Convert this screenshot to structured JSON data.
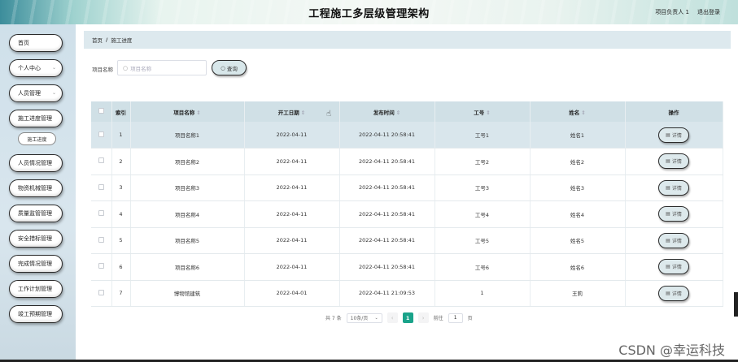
{
  "header": {
    "title": "工程施工多层级管理架构",
    "user_label": "项目负责人 1",
    "logout_label": "退出登录"
  },
  "sidebar": {
    "items": [
      {
        "label": "首页",
        "expandable": false
      },
      {
        "label": "个人中心",
        "expandable": true
      },
      {
        "label": "人员管理",
        "expandable": true
      },
      {
        "label": "施工进度管理",
        "expandable": false
      },
      {
        "label": "人员情况管理",
        "expandable": false
      },
      {
        "label": "物资机械管理",
        "expandable": false
      },
      {
        "label": "质量监管管理",
        "expandable": false
      },
      {
        "label": "安全措标管理",
        "expandable": false
      },
      {
        "label": "完成情况管理",
        "expandable": false
      },
      {
        "label": "工作计划管理",
        "expandable": false
      },
      {
        "label": "竣工预期管理",
        "expandable": false
      }
    ],
    "sub_item": "施工进度"
  },
  "breadcrumb": {
    "home": "首页",
    "separator": "/",
    "current": "施工进度"
  },
  "search": {
    "label": "项目名称",
    "placeholder": "项目名称",
    "button_label": "查询"
  },
  "table": {
    "columns": [
      "索引",
      "项目名称",
      "开工日期",
      "发布时间",
      "工号",
      "姓名",
      "操作"
    ],
    "sortable": [
      false,
      true,
      true,
      true,
      true,
      true,
      false
    ],
    "rows": [
      {
        "index": "1",
        "project": "项目名称1",
        "start": "2022-04-11",
        "time": "2022-04-11 20:58:41",
        "job": "工号1",
        "name": "姓名1"
      },
      {
        "index": "2",
        "project": "项目名称2",
        "start": "2022-04-11",
        "time": "2022-04-11 20:58:41",
        "job": "工号2",
        "name": "姓名2"
      },
      {
        "index": "3",
        "project": "项目名称3",
        "start": "2022-04-11",
        "time": "2022-04-11 20:58:41",
        "job": "工号3",
        "name": "姓名3"
      },
      {
        "index": "4",
        "project": "项目名称4",
        "start": "2022-04-11",
        "time": "2022-04-11 20:58:41",
        "job": "工号4",
        "name": "姓名4"
      },
      {
        "index": "5",
        "project": "项目名称5",
        "start": "2022-04-11",
        "time": "2022-04-11 20:58:41",
        "job": "工号5",
        "name": "姓名5"
      },
      {
        "index": "6",
        "project": "项目名称6",
        "start": "2022-04-11",
        "time": "2022-04-11 20:58:41",
        "job": "工号6",
        "name": "姓名6"
      },
      {
        "index": "7",
        "project": "博物馆建筑",
        "start": "2022-04-01",
        "time": "2022-04-11 21:09:53",
        "job": "1",
        "name": "王莉"
      }
    ],
    "detail_label": "详情",
    "highlighted_row": 0
  },
  "pager": {
    "total": "共 7 条",
    "page_size": "10条/页",
    "current_page": "1",
    "goto_label": "前往",
    "goto_value": "1",
    "page_suffix": "页"
  },
  "watermark": "CSDN @幸运科技",
  "colors": {
    "accent": "#1aa38a",
    "table_header": "#d0e0e6",
    "sidebar_bg": "#cfe0ea"
  }
}
